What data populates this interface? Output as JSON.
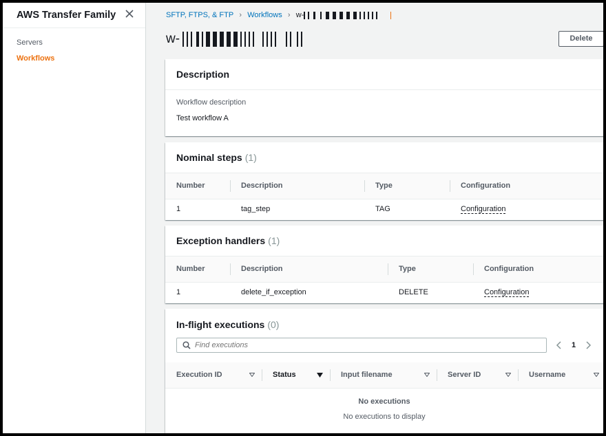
{
  "sidebar": {
    "title": "AWS Transfer Family",
    "items": [
      {
        "label": "Servers",
        "active": false
      },
      {
        "label": "Workflows",
        "active": true
      }
    ]
  },
  "breadcrumbs": {
    "items": [
      "SFTP, FTPS, & FTP",
      "Workflows"
    ],
    "current_prefix": "w-"
  },
  "page": {
    "title_prefix": "w-",
    "delete_label": "Delete"
  },
  "description": {
    "title": "Description",
    "label": "Workflow description",
    "value": "Test workflow A"
  },
  "nominal_steps": {
    "title": "Nominal steps",
    "count": "(1)",
    "columns": [
      "Number",
      "Description",
      "Type",
      "Configuration"
    ],
    "rows": [
      {
        "number": "1",
        "description": "tag_step",
        "type": "TAG",
        "configuration": "Configuration"
      }
    ]
  },
  "exception_handlers": {
    "title": "Exception handlers",
    "count": "(1)",
    "columns": [
      "Number",
      "Description",
      "Type",
      "Configuration"
    ],
    "rows": [
      {
        "number": "1",
        "description": "delete_if_exception",
        "type": "DELETE",
        "configuration": "Configuration"
      }
    ]
  },
  "executions": {
    "title": "In-flight executions",
    "count": "(0)",
    "search_placeholder": "Find executions",
    "page_number": "1",
    "columns": [
      "Execution ID",
      "Status",
      "Input filename",
      "Server ID",
      "Username"
    ],
    "empty_title": "No executions",
    "empty_subtitle": "No executions to display"
  },
  "colors": {
    "accent": "#ec7211",
    "link": "#0073bb",
    "text": "#16191f",
    "muted": "#545b64"
  }
}
